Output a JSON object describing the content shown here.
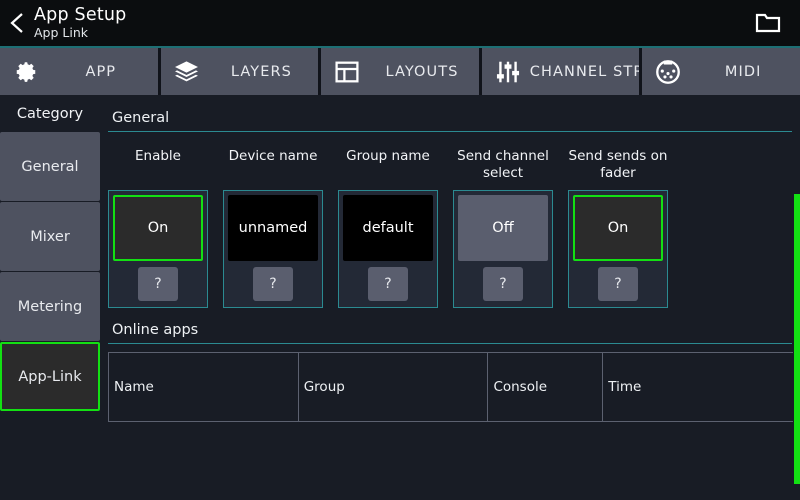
{
  "header": {
    "title": "App Setup",
    "subtitle": "App Link",
    "back_icon": "chevron-left-icon",
    "folder_icon": "folder-open-icon"
  },
  "tabs": [
    {
      "label": "APP",
      "icon": "gear-icon"
    },
    {
      "label": "LAYERS",
      "icon": "layers-icon"
    },
    {
      "label": "LAYOUTS",
      "icon": "layout-grid-icon"
    },
    {
      "label": "CHANNEL STRIP",
      "icon": "faders-icon"
    },
    {
      "label": "MIDI",
      "icon": "midi-din-icon"
    }
  ],
  "sidebar": {
    "header": "Category",
    "items": [
      {
        "label": "General",
        "selected": false
      },
      {
        "label": "Mixer",
        "selected": false
      },
      {
        "label": "Metering",
        "selected": false
      },
      {
        "label": "App-Link",
        "selected": true
      }
    ]
  },
  "main": {
    "general": {
      "title": "General",
      "controls": [
        {
          "label": "Enable",
          "value": "On",
          "state": "on",
          "help": "?"
        },
        {
          "label": "Device name",
          "value": "unnamed",
          "state": "text",
          "help": "?"
        },
        {
          "label": "Group name",
          "value": "default",
          "state": "text",
          "help": "?"
        },
        {
          "label": "Send channel\nselect",
          "value": "Off",
          "state": "off",
          "help": "?"
        },
        {
          "label": "Send sends on\nfader",
          "value": "On",
          "state": "on",
          "help": "?"
        }
      ]
    },
    "online_apps": {
      "title": "Online apps",
      "columns": [
        "Name",
        "Group",
        "Console",
        "Time"
      ],
      "rows": []
    }
  },
  "colors": {
    "accent_green": "#13e013",
    "accent_teal": "#2b8a91",
    "tab_background": "#4e5260",
    "panel_background": "#181c25",
    "card_background": "#232936"
  }
}
